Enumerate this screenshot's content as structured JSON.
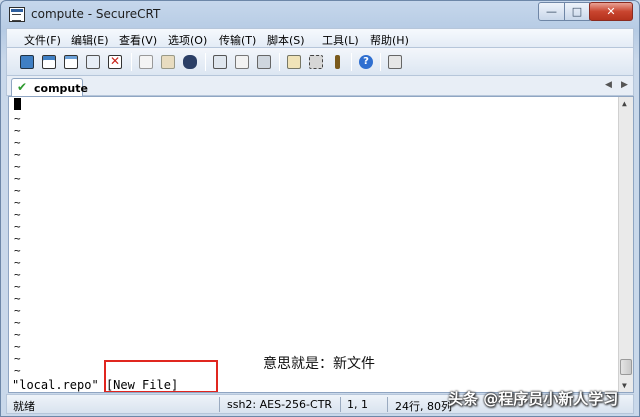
{
  "window": {
    "title": "compute - SecureCRT"
  },
  "menu": [
    {
      "label": "文件(F)"
    },
    {
      "label": "编辑(E)"
    },
    {
      "label": "查看(V)"
    },
    {
      "label": "选项(O)"
    },
    {
      "label": "传输(T)"
    },
    {
      "label": "脚本(S)"
    },
    {
      "label": "工具(L)"
    },
    {
      "label": "帮助(H)"
    }
  ],
  "toolbar": {
    "icons": [
      "connect-icon",
      "quick-connect-icon",
      "connect-tab-icon",
      "reconnect-icon",
      "disconnect-icon",
      "copy-icon",
      "paste-icon",
      "find-icon",
      "print-icon",
      "print-setup-icon",
      "print-screen-icon",
      "session-options-icon",
      "global-options-icon",
      "keymap-icon",
      "help-icon",
      "sftp-icon"
    ],
    "colors": {
      "connect": "#3f7fc4",
      "disconnect": "#c8261d",
      "help": "#2f6fd0"
    }
  },
  "tab": {
    "label": "compute",
    "status": "connected"
  },
  "terminal": {
    "tilde_char": "~",
    "status_file": "\"local.repo\"",
    "status_flag": "[New File]",
    "annotation": "意思就是：新文件"
  },
  "statusbar": {
    "ready": "就绪",
    "protocol": "ssh2: AES-256-CTR",
    "position": "1,  1",
    "size": "24行, 80列"
  },
  "watermark": "头条 @程序员小新人学习"
}
